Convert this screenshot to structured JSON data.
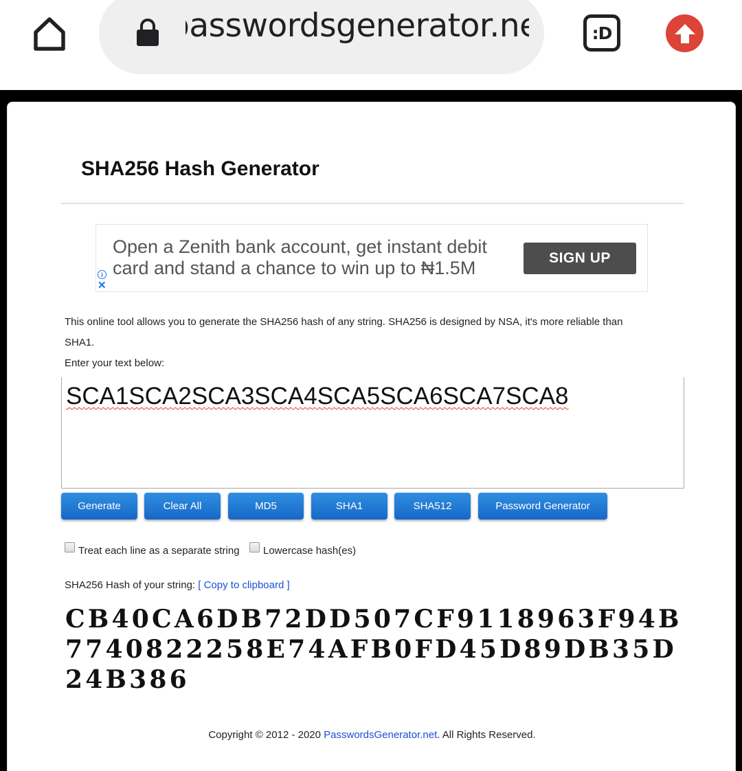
{
  "browser": {
    "url": "passwordsgenerator.net",
    "tab_icon_label": ":D"
  },
  "page": {
    "title": "SHA256 Hash Generator",
    "ad": {
      "text": "Open a Zenith bank account, get instant debit card and stand a chance to win up to ₦1.5M",
      "button_label": "SIGN UP",
      "info_label": "i",
      "close_label": "✕"
    },
    "description": "This online tool allows you to generate the SHA256 hash of any string. SHA256 is designed by NSA, it's more reliable than SHA1.",
    "input_label": "Enter your text below:",
    "input_value": "SCA1SCA2SCA3SCA4SCA5SCA6SCA7SCA8",
    "buttons": [
      {
        "label": "Generate"
      },
      {
        "label": "Clear All"
      },
      {
        "label": "MD5"
      },
      {
        "label": "SHA1"
      },
      {
        "label": "SHA512"
      },
      {
        "label": "Password Generator"
      }
    ],
    "options": {
      "separate_lines_label": "Treat each line as a separate string",
      "separate_lines_checked": false,
      "lowercase_label": "Lowercase hash(es)",
      "lowercase_checked": false
    },
    "result_label": "SHA256 Hash of your string:",
    "copy_label": "[ Copy to clipboard ]",
    "hash_value": "CB40CA6DB72DD507CF9118963F94B7740822258E74AFB0FD45D89DB35D24B386",
    "footer": {
      "prefix": "Copyright © 2012 - 2020",
      "link": "PasswordsGenerator.net",
      "suffix": ". All Rights Reserved."
    }
  },
  "colors": {
    "button_top": "#2f8fe0",
    "button_bottom": "#1768c8",
    "link": "#1a4fd6",
    "upload_button": "#db4437",
    "ad_button": "#4d4d4d"
  }
}
